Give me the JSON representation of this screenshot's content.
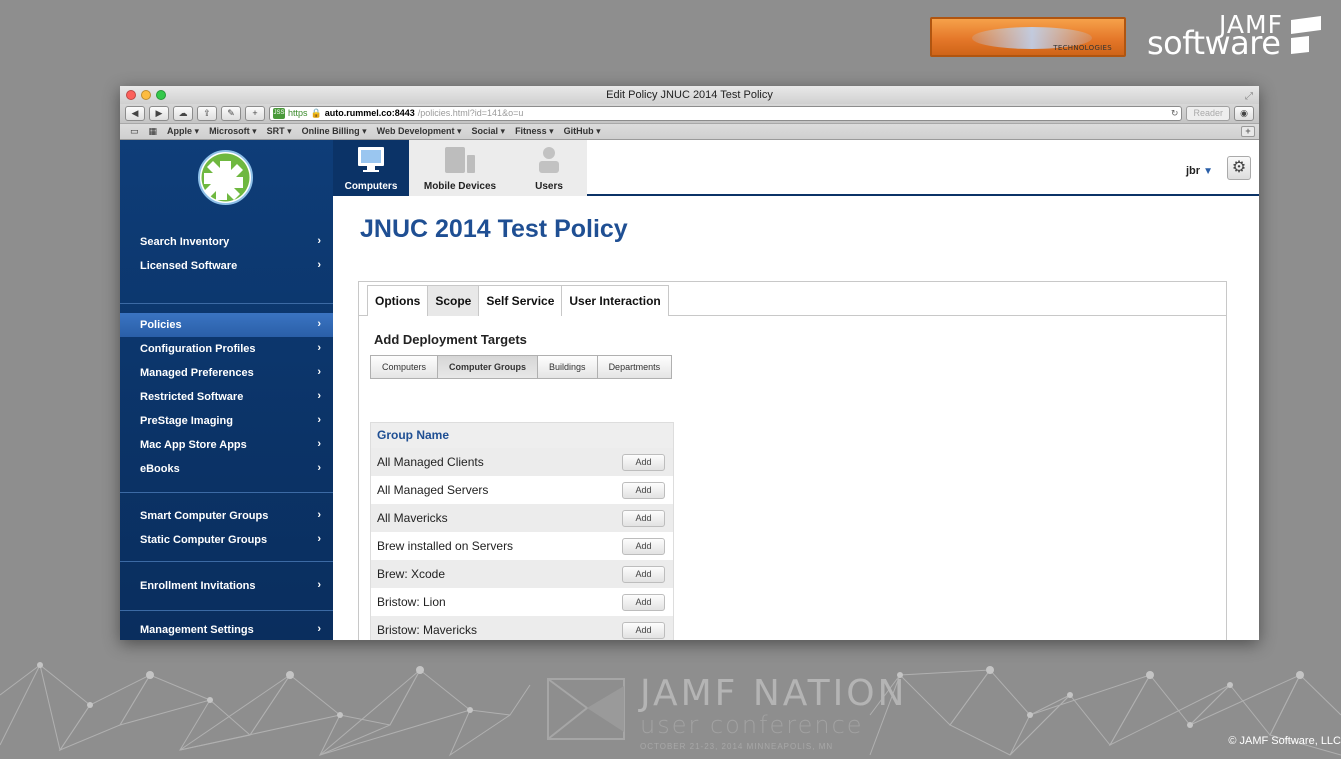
{
  "slide": {
    "sponsor_logo_text": "TECHNOLOGIES",
    "brand_top": "JAMF",
    "brand_bottom": "software",
    "conference_title": "JAMF NATION",
    "conference_subtitle": "user conference",
    "conference_date": "OCTOBER 21-23, 2014 MINNEAPOLIS, MN",
    "copyright": "© JAMF Software, LLC"
  },
  "browser": {
    "window_title": "Edit Policy JNUC 2014 Test Policy",
    "url_scheme": "https",
    "url_host": "auto.rummel.co:8443",
    "url_path": "/policies.html?id=141&o=u",
    "reader_label": "Reader",
    "bookmarks": [
      "Apple ▾",
      "Microsoft ▾",
      "SRT ▾",
      "Online Billing ▾",
      "Web Development ▾",
      "Social ▾",
      "Fitness ▾",
      "GitHub ▾"
    ]
  },
  "topnav": {
    "tabs": [
      "Computers",
      "Mobile Devices",
      "Users"
    ],
    "active_tab": "Computers",
    "user": "jbr"
  },
  "sidebar": {
    "group1": [
      "Search Inventory",
      "Licensed Software"
    ],
    "group2": [
      "Policies",
      "Configuration Profiles",
      "Managed Preferences",
      "Restricted Software",
      "PreStage Imaging",
      "Mac App Store Apps",
      "eBooks"
    ],
    "group3": [
      "Smart Computer Groups",
      "Static Computer Groups"
    ],
    "group4": [
      "Enrollment Invitations"
    ],
    "group5": [
      "Management Settings"
    ],
    "active_item": "Policies"
  },
  "main": {
    "page_title": "JNUC 2014 Test Policy",
    "tabs": [
      "Options",
      "Scope",
      "Self Service",
      "User Interaction"
    ],
    "active_tab": "Scope",
    "section_title": "Add Deployment Targets",
    "target_types": [
      "Computers",
      "Computer Groups",
      "Buildings",
      "Departments"
    ],
    "active_target_type": "Computer Groups",
    "table_header": "Group Name",
    "add_label": "Add",
    "groups": [
      "All Managed Clients",
      "All Managed Servers",
      "All Mavericks",
      "Brew installed on Servers",
      "Brew: Xcode",
      "Bristow: Lion",
      "Bristow: Mavericks"
    ]
  },
  "colors": {
    "sidebar_bg": "#0b3367",
    "title_blue": "#1f4f93",
    "active_nav": "#2a5fa8"
  }
}
